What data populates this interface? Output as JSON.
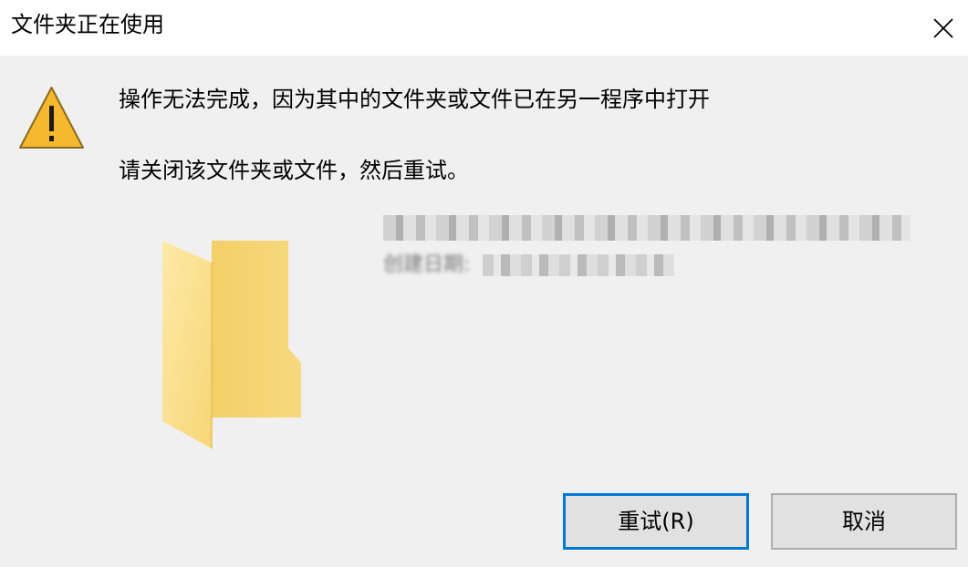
{
  "window": {
    "title": "文件夹正在使用"
  },
  "message": {
    "main": "操作无法完成，因为其中的文件夹或文件已在另一程序中打开",
    "sub": "请关闭该文件夹或文件，然后重试。"
  },
  "item": {
    "created_label": "创建日期:"
  },
  "buttons": {
    "retry_label": "重试(R)",
    "cancel_label": "取消"
  },
  "colors": {
    "accent": "#0078d7",
    "warning": "#f5b82e",
    "folder": "#f8d775"
  },
  "icons": {
    "close": "close-icon",
    "warning": "warning-icon",
    "folder": "folder-icon"
  }
}
